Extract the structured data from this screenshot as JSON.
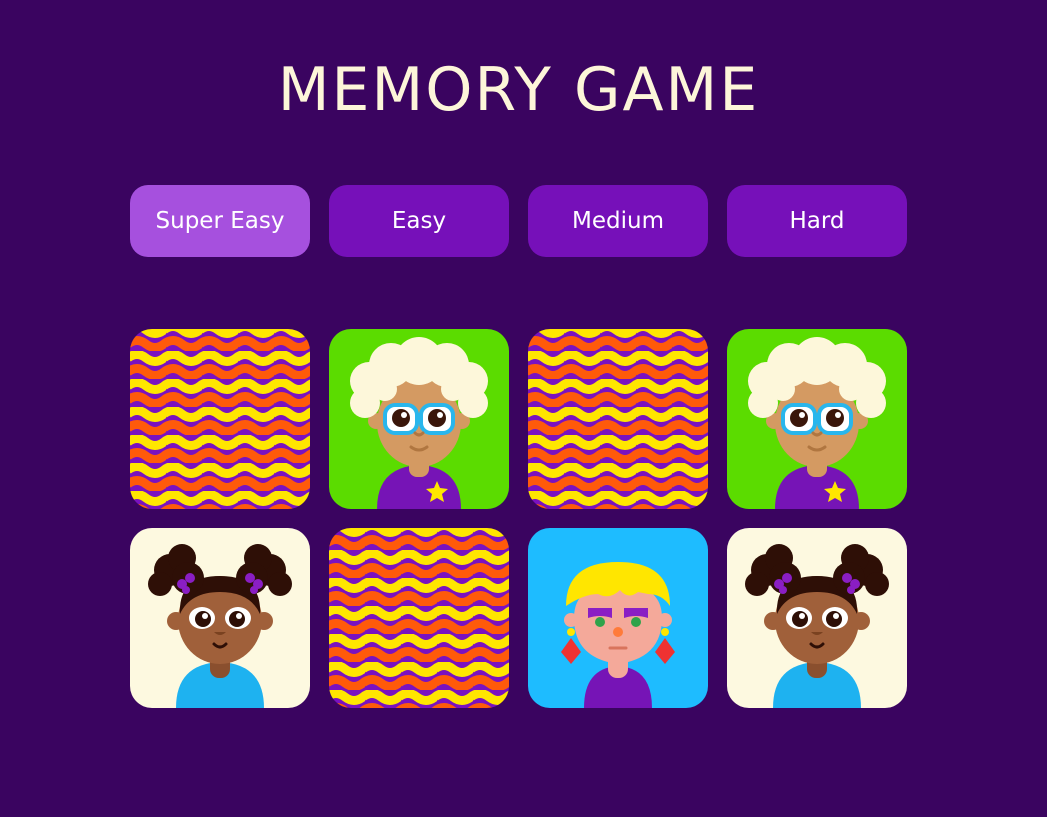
{
  "title": "MEMORY GAME",
  "levels": [
    {
      "label": "Super Easy",
      "selected": true
    },
    {
      "label": "Easy",
      "selected": false
    },
    {
      "label": "Medium",
      "selected": false
    },
    {
      "label": "Hard",
      "selected": false
    }
  ],
  "colors": {
    "background": "#3a0460",
    "button": "#7610b9",
    "button_active": "#a650de",
    "title": "#fdf6d9",
    "card_back_purple": "#7a12c0",
    "card_back_yellow": "#ffe600",
    "card_back_orange": "#ff5a0a"
  },
  "cards": [
    {
      "state": "face-down",
      "face": null
    },
    {
      "state": "face-up",
      "face": "grandma-with-glasses"
    },
    {
      "state": "face-down",
      "face": null
    },
    {
      "state": "face-up",
      "face": "grandma-with-glasses"
    },
    {
      "state": "face-up",
      "face": "girl-with-puffs"
    },
    {
      "state": "face-down",
      "face": null
    },
    {
      "state": "face-up",
      "face": "blonde-woman"
    },
    {
      "state": "face-up",
      "face": "girl-with-puffs"
    }
  ]
}
